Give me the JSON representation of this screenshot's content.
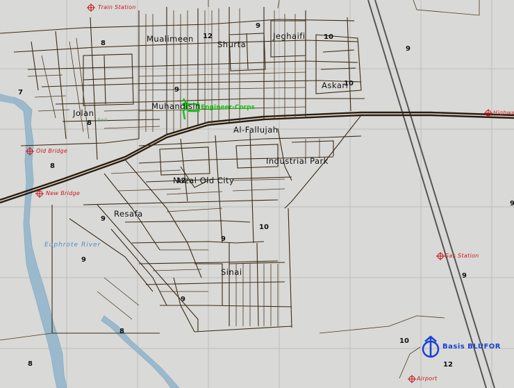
{
  "districts": {
    "mualimeen": "Mualimeen",
    "shurta": "Shurta",
    "jeghaifi": "Jeghaifi",
    "askari": "Askari",
    "jolan": "Jolan",
    "muhandisin": "Muhandisin",
    "al_fallujah": "Al-Fallujah",
    "industrial_park": "Industrial Park",
    "nazal_old_city": "Nazal Old City",
    "resafa": "Resafa",
    "sinai": "Sinai"
  },
  "pois": {
    "train_station": "Train Station",
    "old_bridge": "Old Bridge",
    "new_bridge": "New Bridge",
    "highway": "Highwa",
    "gas_station": "Gas Station",
    "airport": "Airport"
  },
  "river": "Euphrote River",
  "faint_park": "Park",
  "markers": {
    "engineer_corps": "Engineer-Corps",
    "basis_blufor": "Basis BLUFOR"
  },
  "elevations": [
    "8",
    "12",
    "9",
    "10",
    "9",
    "10",
    "7",
    "9",
    "8",
    "8",
    "12",
    "9",
    "9",
    "10",
    "9",
    "9",
    "8",
    "9",
    "10",
    "12",
    "8",
    "9"
  ],
  "colors": {
    "background": "#d9d9d7",
    "roads": "#3a2a14",
    "grid": "#b9b9b6",
    "river": "#9bb9cc",
    "poi": "#c71a1a",
    "engineer": "#13c313",
    "blufor": "#1540d6"
  }
}
